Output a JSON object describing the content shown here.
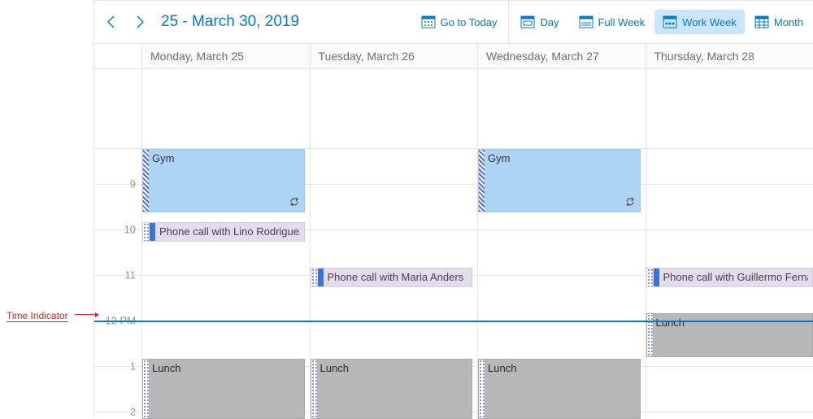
{
  "annotation": {
    "label": "Time Indicator"
  },
  "toolbar": {
    "date_range": "25 - March 30, 2019",
    "go_to_today": "Go to Today",
    "views": {
      "day": "Day",
      "full_week": "Full Week",
      "work_week": "Work Week",
      "month": "Month"
    }
  },
  "days": [
    {
      "label": "Monday, March 25"
    },
    {
      "label": "Tuesday, March 26"
    },
    {
      "label": "Wednesday, March 27"
    },
    {
      "label": "Thursday, March 28"
    }
  ],
  "time_labels": {
    "t9": "9",
    "t10": "10",
    "t11": "11",
    "t12": "12 PM",
    "t1": "1",
    "t2": "2"
  },
  "events": {
    "gym1": "Gym",
    "gym2": "Gym",
    "call_lino": "Phone call with Lino Rodriguez",
    "call_maria": "Phone call with Maria Anders",
    "call_gui": "Phone call with Guillermo Fernandez",
    "lunch1": "Lunch",
    "lunch2": "Lunch",
    "lunch3": "Lunch",
    "lunch4": "Lunch"
  }
}
